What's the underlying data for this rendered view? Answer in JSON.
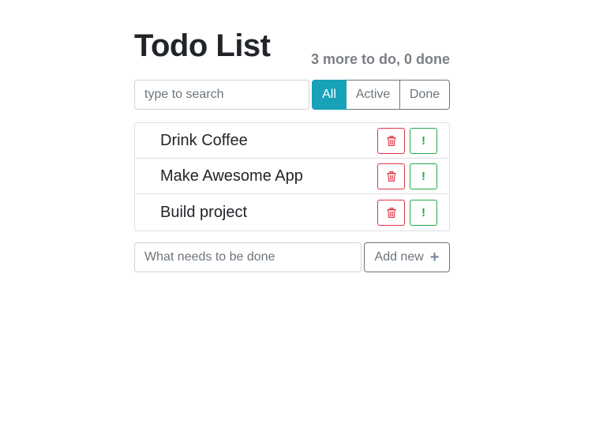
{
  "header": {
    "title": "Todo List",
    "stats": "3 more to do, 0 done"
  },
  "search": {
    "placeholder": "type to search",
    "value": ""
  },
  "filters": [
    {
      "label": "All",
      "active": true
    },
    {
      "label": "Active",
      "active": false
    },
    {
      "label": "Done",
      "active": false
    }
  ],
  "todos": [
    {
      "label": "Drink Coffee"
    },
    {
      "label": "Make Awesome App"
    },
    {
      "label": "Build project"
    }
  ],
  "icons": {
    "delete": "trash-icon",
    "important": "exclamation-icon",
    "add": "plus-icon",
    "important_glyph": "!",
    "add_glyph": "+"
  },
  "add_form": {
    "placeholder": "What needs to be done",
    "value": "",
    "button_label": "Add new"
  },
  "colors": {
    "accent": "#17a2b8",
    "danger": "#dc3545",
    "success": "#28a745",
    "muted": "#6c757d"
  }
}
